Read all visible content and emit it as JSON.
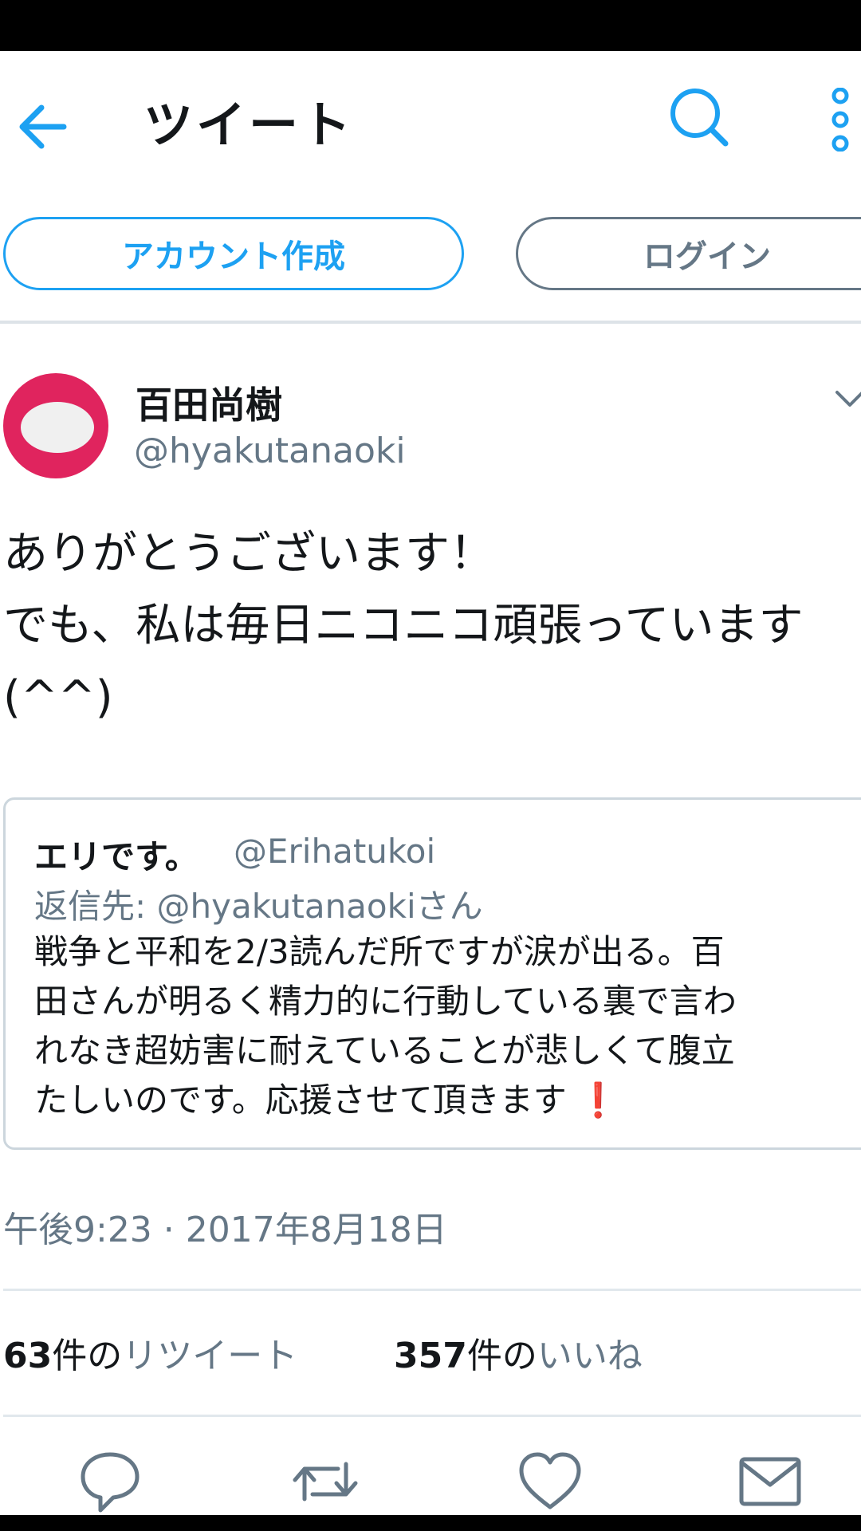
{
  "header": {
    "title": "ツイート",
    "back_icon": "back-arrow-icon",
    "search_icon": "search-icon",
    "more_icon": "more-vertical-icon",
    "accent_color": "#1da1f2"
  },
  "auth": {
    "signup_label": "アカウント作成",
    "login_label": "ログイン"
  },
  "tweet": {
    "author_name": "百田尚樹",
    "author_handle": "@hyakutanaoki",
    "avatar_color": "#e0245e",
    "text": "ありがとうございます！\nでも、私は毎日ニコニコ頑張っています\n(^^)",
    "timestamp": "午後9:23 · 2017年8月18日"
  },
  "quote": {
    "author_name": "エリです。",
    "author_handle": "@Erihatukoi",
    "reply_to": "返信先: @hyakutanaokiさん",
    "text": "戦争と平和を2/3読んだ所ですが涙が出る。百\n田さんが明るく精力的に行動している裏で言わ\nれなき超妨害に耐えていることが悲しくて腹立\nたしいのです。応援させて頂きます ",
    "emoji": "❗"
  },
  "stats": {
    "retweet_count": "63",
    "retweet_mid": "件の",
    "retweet_label": "リツイート",
    "like_count": "357",
    "like_mid": "件の",
    "like_label": "いいね"
  },
  "actions": [
    "reply-icon",
    "retweet-icon",
    "like-icon",
    "direct-message-icon"
  ]
}
